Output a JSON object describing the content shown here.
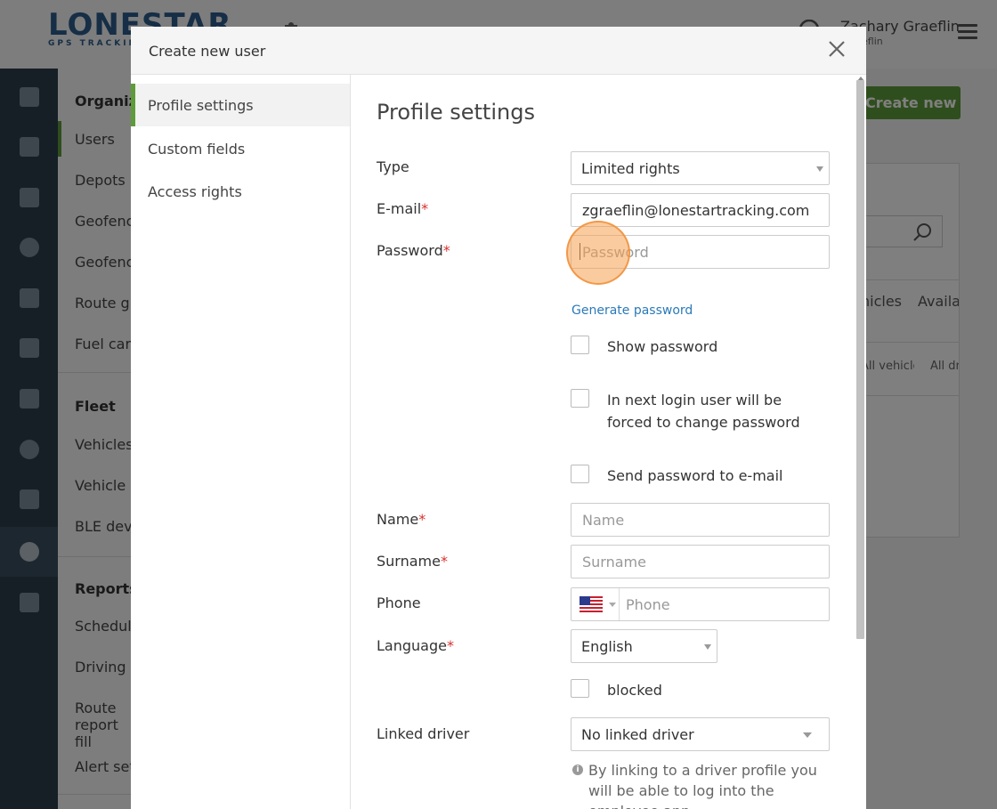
{
  "app": {
    "logo_main": "LONESTAR",
    "logo_sub": "GPS TRACKING",
    "user_name": "Zachary Graeflin",
    "user_sub": "zgraeflin",
    "create_user_button": "Create new user"
  },
  "subnav": {
    "sections": [
      {
        "heading": "Organization",
        "items": [
          "Users",
          "Depots",
          "Geofences",
          "Geofence groups",
          "Route groups",
          "Fuel cards"
        ]
      },
      {
        "heading": "Fleet",
        "items": [
          "Vehicles",
          "Vehicle groups",
          "BLE devices"
        ]
      },
      {
        "heading": "Reports",
        "items": [
          "Scheduled reports",
          "Driving log",
          "Route report fill",
          "Alert settings"
        ]
      }
    ]
  },
  "bg_table": {
    "col1_head": "Available vehicles",
    "col2_head": "Available drivers",
    "col1_sub": "All vehicles",
    "col2_sub": "All drivers"
  },
  "modal": {
    "title": "Create new user",
    "tabs": [
      "Profile settings",
      "Custom fields",
      "Access rights"
    ],
    "active_tab": "Profile settings",
    "section_title": "Profile settings",
    "fields": {
      "type": {
        "label": "Type",
        "value": "Limited rights"
      },
      "email": {
        "label": "E-mail",
        "value": "zgraeflin@lonestartracking.com",
        "required": "*"
      },
      "password": {
        "label": "Password",
        "placeholder": "Password",
        "required": "*"
      },
      "generate_password": "Generate password",
      "show_password": "Show password",
      "force_change": "In next login user will be forced to change password",
      "send_email": "Send password to e-mail",
      "name": {
        "label": "Name",
        "placeholder": "Name",
        "required": "*"
      },
      "surname": {
        "label": "Surname",
        "placeholder": "Surname",
        "required": "*"
      },
      "phone": {
        "label": "Phone",
        "placeholder": "Phone"
      },
      "language": {
        "label": "Language",
        "value": "English",
        "required": "*"
      },
      "blocked": "blocked",
      "linked_driver": {
        "label": "Linked driver",
        "value": "No linked driver"
      },
      "hint": "By linking to a driver profile you will be able to log into the employee app"
    }
  },
  "colors": {
    "accent_green": "#5e9c3a",
    "link_blue": "#2a7ab8",
    "required_red": "#d9302f",
    "rail_bg": "#2c3e4c"
  }
}
